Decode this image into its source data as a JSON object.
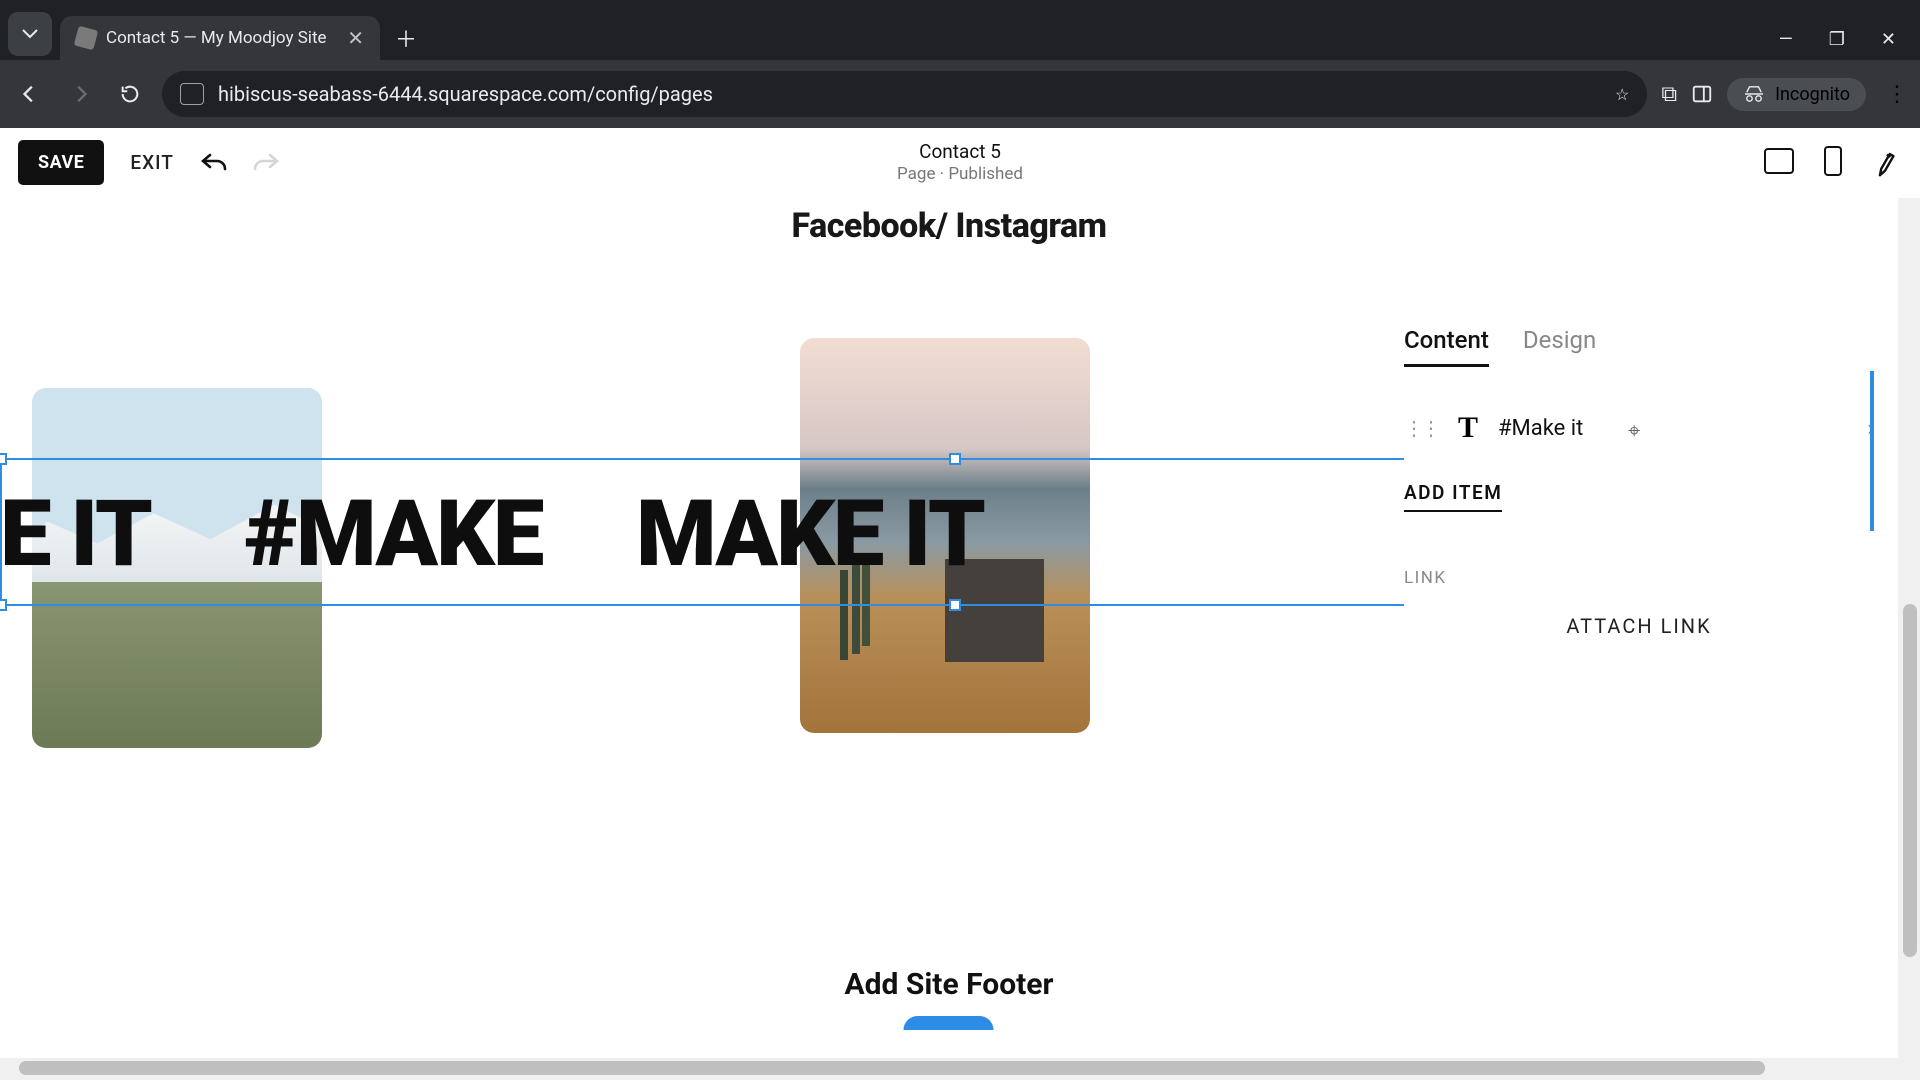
{
  "browser": {
    "tab_title": "Contact 5 — My Moodjoy Site",
    "url": "hibiscus-seabass-6444.squarespace.com/config/pages",
    "incognito_label": "Incognito"
  },
  "editor": {
    "save_label": "SAVE",
    "exit_label": "EXIT",
    "page_title": "Contact 5",
    "page_status": "Page · Published"
  },
  "canvas": {
    "social_heading": "Facebook/ Instagram",
    "marquee_a": "E IT",
    "marquee_b": "#MAKE",
    "marquee_c": "MAKE IT",
    "footer_label": "Add Site Footer"
  },
  "panel": {
    "tab_content": "Content",
    "tab_design": "Design",
    "item_label": "#Make it",
    "add_item": "ADD ITEM",
    "link_section": "LINK",
    "attach_link": "ATTACH LINK"
  },
  "colors": {
    "selection": "#2f8de4"
  }
}
